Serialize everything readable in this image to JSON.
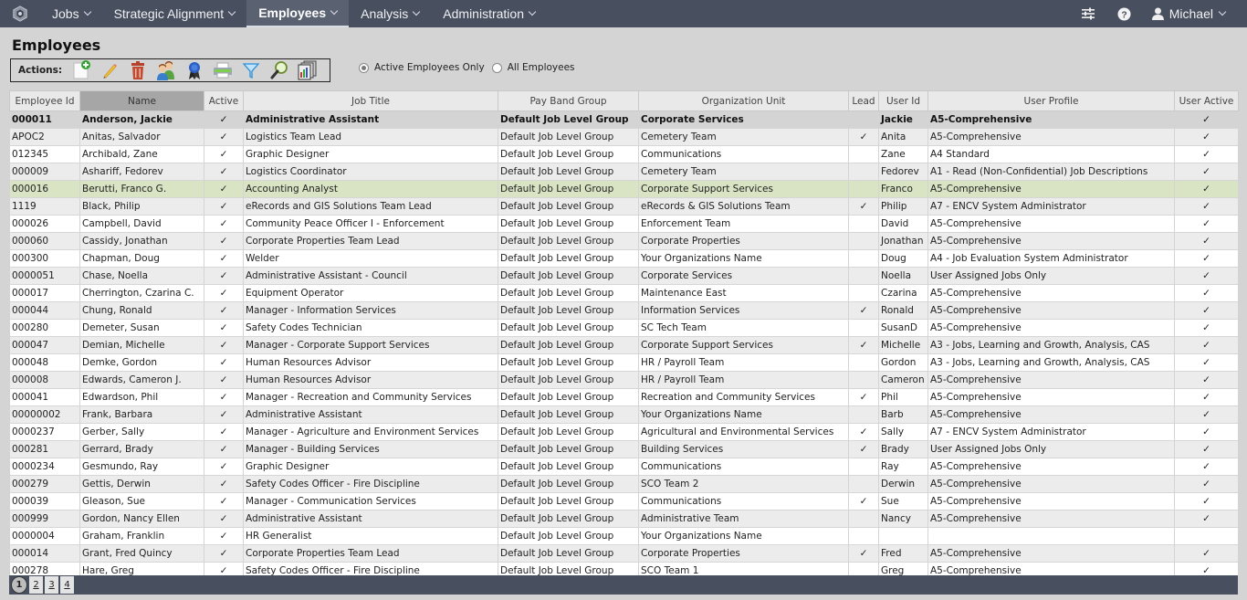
{
  "nav": {
    "items": [
      {
        "label": "Jobs",
        "active": false
      },
      {
        "label": "Strategic Alignment",
        "active": false
      },
      {
        "label": "Employees",
        "active": true
      },
      {
        "label": "Analysis",
        "active": false
      },
      {
        "label": "Administration",
        "active": false
      }
    ],
    "user_name": "Michael"
  },
  "page": {
    "title": "Employees",
    "actions_label": "Actions:",
    "actions": [
      "add-employee",
      "edit",
      "delete",
      "users",
      "award-ribbon",
      "print",
      "filter",
      "search",
      "reports"
    ],
    "filter_options": [
      {
        "label": "Active Employees Only",
        "checked": true
      },
      {
        "label": "All Employees",
        "checked": false
      }
    ]
  },
  "table": {
    "columns": [
      "Employee Id",
      "Name",
      "Active",
      "Job Title",
      "Pay Band Group",
      "Organization Unit",
      "Lead",
      "User Id",
      "User Profile",
      "User Active"
    ],
    "sorted_column": "Name",
    "check_glyph": "✓",
    "rows": [
      {
        "id": "000011",
        "name": "Anderson, Jackie",
        "active": true,
        "job": "Administrative Assistant",
        "pay": "Default Job Level Group",
        "org": "Corporate Services",
        "lead": false,
        "uid": "Jackie",
        "profile": "A5-Comprehensive",
        "uactive": true,
        "state": "selected"
      },
      {
        "id": "APOC2",
        "name": "Anitas, Salvador",
        "active": true,
        "job": "Logistics Team Lead",
        "pay": "Default Job Level Group",
        "org": "Cemetery Team",
        "lead": true,
        "uid": "Anita",
        "profile": "A5-Comprehensive",
        "uactive": true
      },
      {
        "id": "012345",
        "name": "Archibald, Zane",
        "active": true,
        "job": "Graphic Designer",
        "pay": "Default Job Level Group",
        "org": "Communications",
        "lead": false,
        "uid": "Zane",
        "profile": "A4 Standard",
        "uactive": true
      },
      {
        "id": "000009",
        "name": "Ashariff, Fedorev",
        "active": true,
        "job": "Logistics Coordinator",
        "pay": "Default Job Level Group",
        "org": "Cemetery Team",
        "lead": false,
        "uid": "Fedorev",
        "profile": "A1 - Read (Non-Confidential) Job Descriptions",
        "uactive": true
      },
      {
        "id": "000016",
        "name": "Berutti, Franco G.",
        "active": true,
        "job": "Accounting Analyst",
        "pay": "Default Job Level Group",
        "org": "Corporate Support Services",
        "lead": false,
        "uid": "Franco",
        "profile": "A5-Comprehensive",
        "uactive": true,
        "state": "highlight"
      },
      {
        "id": "1119",
        "name": "Black, Philip",
        "active": true,
        "job": "eRecords and GIS Solutions Team Lead",
        "pay": "Default Job Level Group",
        "org": "eRecords & GIS Solutions Team",
        "lead": true,
        "uid": "Philip",
        "profile": "A7 - ENCV System Administrator",
        "uactive": true
      },
      {
        "id": "000026",
        "name": "Campbell, David",
        "active": true,
        "job": "Community Peace Officer I - Enforcement",
        "pay": "Default Job Level Group",
        "org": "Enforcement Team",
        "lead": false,
        "uid": "David",
        "profile": "A5-Comprehensive",
        "uactive": true
      },
      {
        "id": "000060",
        "name": "Cassidy, Jonathan",
        "active": true,
        "job": "Corporate Properties Team Lead",
        "pay": "Default Job Level Group",
        "org": "Corporate Properties",
        "lead": false,
        "uid": "Jonathan",
        "profile": "A5-Comprehensive",
        "uactive": true
      },
      {
        "id": "000300",
        "name": "Chapman, Doug",
        "active": true,
        "job": "Welder",
        "pay": "Default Job Level Group",
        "org": "Your Organizations Name",
        "lead": false,
        "uid": "Doug",
        "profile": "A4 - Job Evaluation System Administrator",
        "uactive": true
      },
      {
        "id": "0000051",
        "name": "Chase, Noella",
        "active": true,
        "job": "Administrative Assistant - Council",
        "pay": "Default Job Level Group",
        "org": "Corporate Services",
        "lead": false,
        "uid": "Noella",
        "profile": "User Assigned Jobs Only",
        "uactive": true
      },
      {
        "id": "000017",
        "name": "Cherrington, Czarina C.",
        "active": true,
        "job": "Equipment Operator",
        "pay": "Default Job Level Group",
        "org": "Maintenance East",
        "lead": false,
        "uid": "Czarina",
        "profile": "A5-Comprehensive",
        "uactive": true
      },
      {
        "id": "000044",
        "name": "Chung, Ronald",
        "active": true,
        "job": "Manager - Information Services",
        "pay": "Default Job Level Group",
        "org": "Information Services",
        "lead": true,
        "uid": "Ronald",
        "profile": "A5-Comprehensive",
        "uactive": true
      },
      {
        "id": "000280",
        "name": "Demeter, Susan",
        "active": true,
        "job": "Safety Codes Technician",
        "pay": "Default Job Level Group",
        "org": "SC Tech Team",
        "lead": false,
        "uid": "SusanD",
        "profile": "A5-Comprehensive",
        "uactive": true
      },
      {
        "id": "000047",
        "name": "Demian, Michelle",
        "active": true,
        "job": "Manager - Corporate Support Services",
        "pay": "Default Job Level Group",
        "org": "Corporate Support Services",
        "lead": true,
        "uid": "Michelle",
        "profile": "A3 - Jobs, Learning and Growth, Analysis, CAS",
        "uactive": true
      },
      {
        "id": "000048",
        "name": "Demke, Gordon",
        "active": true,
        "job": "Human Resources Advisor",
        "pay": "Default Job Level Group",
        "org": "HR / Payroll Team",
        "lead": false,
        "uid": "Gordon",
        "profile": "A3 - Jobs, Learning and Growth, Analysis, CAS",
        "uactive": true
      },
      {
        "id": "000008",
        "name": "Edwards, Cameron J.",
        "active": true,
        "job": "Human Resources Advisor",
        "pay": "Default Job Level Group",
        "org": "HR / Payroll Team",
        "lead": false,
        "uid": "Cameron",
        "profile": "A5-Comprehensive",
        "uactive": true
      },
      {
        "id": "000041",
        "name": "Edwardson, Phil",
        "active": true,
        "job": "Manager - Recreation and Community Services",
        "pay": "Default Job Level Group",
        "org": "Recreation and Community Services",
        "lead": true,
        "uid": "Phil",
        "profile": "A5-Comprehensive",
        "uactive": true
      },
      {
        "id": "00000002",
        "name": "Frank, Barbara",
        "active": true,
        "job": "Administrative Assistant",
        "pay": "Default Job Level Group",
        "org": "Your Organizations Name",
        "lead": false,
        "uid": "Barb",
        "profile": "A5-Comprehensive",
        "uactive": true
      },
      {
        "id": "0000237",
        "name": "Gerber, Sally",
        "active": true,
        "job": "Manager - Agriculture and Environment Services",
        "pay": "Default Job Level Group",
        "org": "Agricultural and Environmental Services",
        "lead": true,
        "uid": "Sally",
        "profile": "A7 - ENCV System Administrator",
        "uactive": true
      },
      {
        "id": "000281",
        "name": "Gerrard, Brady",
        "active": true,
        "job": "Manager - Building Services",
        "pay": "Default Job Level Group",
        "org": "Building Services",
        "lead": true,
        "uid": "Brady",
        "profile": "User Assigned Jobs Only",
        "uactive": true
      },
      {
        "id": "0000234",
        "name": "Gesmundo, Ray",
        "active": true,
        "job": "Graphic Designer",
        "pay": "Default Job Level Group",
        "org": "Communications",
        "lead": false,
        "uid": "Ray",
        "profile": "A5-Comprehensive",
        "uactive": true
      },
      {
        "id": "000279",
        "name": "Gettis, Derwin",
        "active": true,
        "job": "Safety Codes Officer - Fire Discipline",
        "pay": "Default Job Level Group",
        "org": "SCO Team 2",
        "lead": false,
        "uid": "Derwin",
        "profile": "A5-Comprehensive",
        "uactive": true
      },
      {
        "id": "000039",
        "name": "Gleason, Sue",
        "active": true,
        "job": "Manager - Communication Services",
        "pay": "Default Job Level Group",
        "org": "Communications",
        "lead": true,
        "uid": "Sue",
        "profile": "A5-Comprehensive",
        "uactive": true
      },
      {
        "id": "000999",
        "name": "Gordon, Nancy Ellen",
        "active": true,
        "job": "Administrative Assistant",
        "pay": "Default Job Level Group",
        "org": "Administrative Team",
        "lead": false,
        "uid": "Nancy",
        "profile": "A5-Comprehensive",
        "uactive": true
      },
      {
        "id": "0000004",
        "name": "Graham, Franklin",
        "active": true,
        "job": "HR Generalist",
        "pay": "Default Job Level Group",
        "org": "Your Organizations Name",
        "lead": false,
        "uid": "",
        "profile": "",
        "uactive": false
      },
      {
        "id": "000014",
        "name": "Grant, Fred Quincy",
        "active": true,
        "job": "Corporate Properties Team Lead",
        "pay": "Default Job Level Group",
        "org": "Corporate Properties",
        "lead": true,
        "uid": "Fred",
        "profile": "A5-Comprehensive",
        "uactive": true
      },
      {
        "id": "000278",
        "name": "Hare, Greg",
        "active": true,
        "job": "Safety Codes Officer - Fire Discipline",
        "pay": "Default Job Level Group",
        "org": "SCO Team 1",
        "lead": false,
        "uid": "Greg",
        "profile": "A5-Comprehensive",
        "uactive": true
      }
    ]
  },
  "pager": {
    "pages": [
      "1",
      "2",
      "3",
      "4"
    ],
    "current": "1"
  },
  "colors": {
    "nav_bg": "#484f5e",
    "selected_row": "#d4d4d4",
    "highlight_row": "#d9e4c4"
  }
}
